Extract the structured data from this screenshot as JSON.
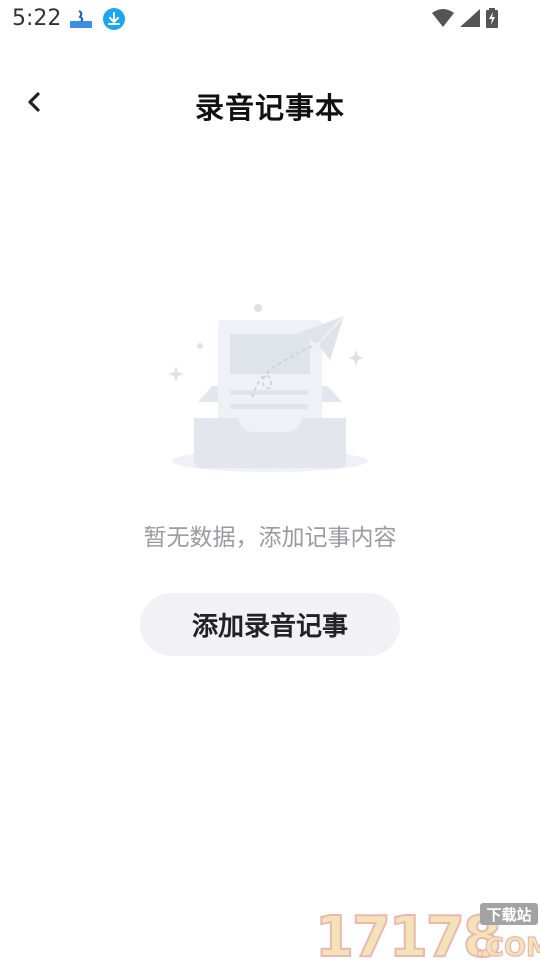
{
  "status_bar": {
    "time": "5:22",
    "icons": [
      "app-notification-icon",
      "download-icon",
      "wifi-icon",
      "signal-icon",
      "battery-charging-icon"
    ]
  },
  "header": {
    "title": "录音记事本",
    "back_icon": "chevron-left-icon"
  },
  "empty_state": {
    "illustration": "empty-inbox-paper-plane",
    "message": "暂无数据，添加记事内容"
  },
  "actions": {
    "add_button_label": "添加录音记事"
  },
  "watermark": {
    "number_text": "17178",
    "domain_suffix": ".COM",
    "badge_text": "下载站"
  },
  "colors": {
    "background": "#ffffff",
    "title": "#111111",
    "empty_text": "#9a9aa0",
    "button_bg": "#f2f1f6",
    "button_text": "#222222",
    "illustration": "#e8ebf0"
  }
}
